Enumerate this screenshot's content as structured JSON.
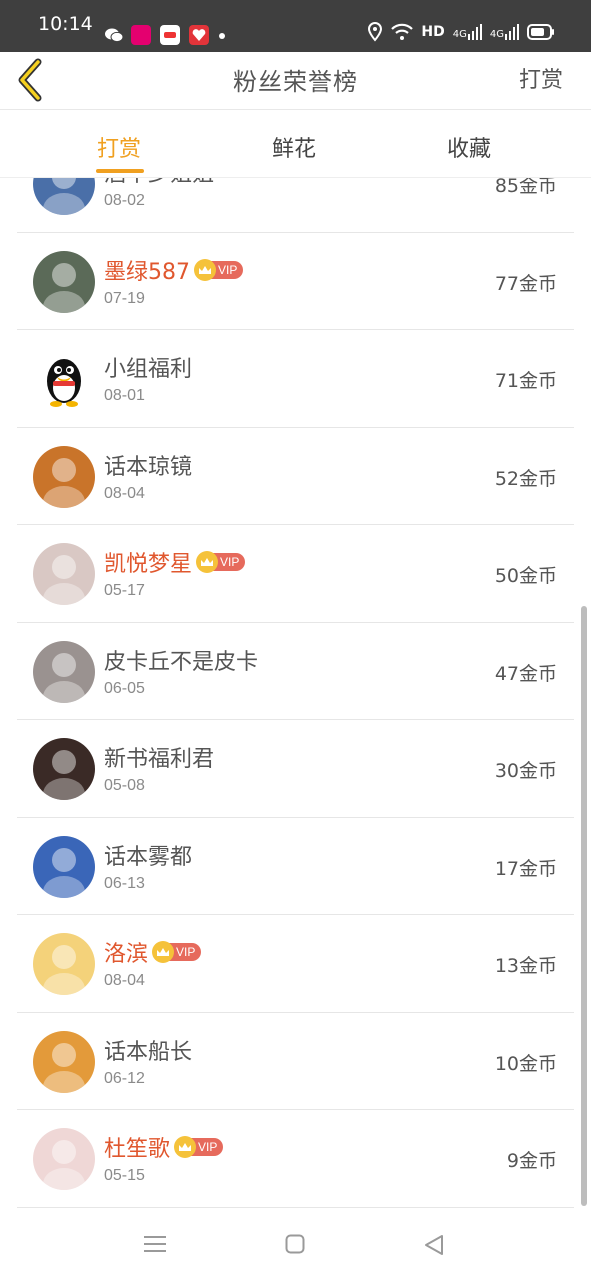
{
  "status_bar": {
    "time": "10:14",
    "network": "HD",
    "signal1": "4G",
    "signal2": "4G"
  },
  "header": {
    "title": "粉丝荣誉榜",
    "action": "打赏",
    "back_icon": "chevron-left-icon"
  },
  "tabs": [
    {
      "label": "打赏",
      "active": true
    },
    {
      "label": "鲜花",
      "active": false
    },
    {
      "label": "收藏",
      "active": false
    }
  ],
  "accent_color": "#f0a020",
  "vip_name_color": "#e0572e",
  "vip_badge_label": "VIP",
  "rows": [
    {
      "name": "酒中少姐姐",
      "date": "08-02",
      "amount": "85金币",
      "vip": false,
      "avatar_color": "#4a6fa8"
    },
    {
      "name": "墨绿587",
      "date": "07-19",
      "amount": "77金币",
      "vip": true,
      "avatar_color": "#5b6a58"
    },
    {
      "name": "小组福利",
      "date": "08-01",
      "amount": "71金币",
      "vip": false,
      "avatar_color": "#ffffff"
    },
    {
      "name": "话本琼镜",
      "date": "08-04",
      "amount": "52金币",
      "vip": false,
      "avatar_color": "#c9742a"
    },
    {
      "name": "凯悦梦星",
      "date": "05-17",
      "amount": "50金币",
      "vip": true,
      "avatar_color": "#d9c8c4"
    },
    {
      "name": "皮卡丘不是皮卡",
      "date": "06-05",
      "amount": "47金币",
      "vip": false,
      "avatar_color": "#9a9290"
    },
    {
      "name": "新书福利君",
      "date": "05-08",
      "amount": "30金币",
      "vip": false,
      "avatar_color": "#3a2a26"
    },
    {
      "name": "话本雾都",
      "date": "06-13",
      "amount": "17金币",
      "vip": false,
      "avatar_color": "#3a66b8"
    },
    {
      "name": "洛滨",
      "date": "08-04",
      "amount": "13金币",
      "vip": true,
      "avatar_color": "#f4d27a"
    },
    {
      "name": "话本船长",
      "date": "06-12",
      "amount": "10金币",
      "vip": false,
      "avatar_color": "#e39a3a"
    },
    {
      "name": "杜笙歌",
      "date": "05-15",
      "amount": "9金币",
      "vip": true,
      "avatar_color": "#efd7d6"
    }
  ],
  "nav": {
    "menu_icon": "menu-icon",
    "home_icon": "home-square-icon",
    "back_icon": "back-triangle-icon"
  }
}
